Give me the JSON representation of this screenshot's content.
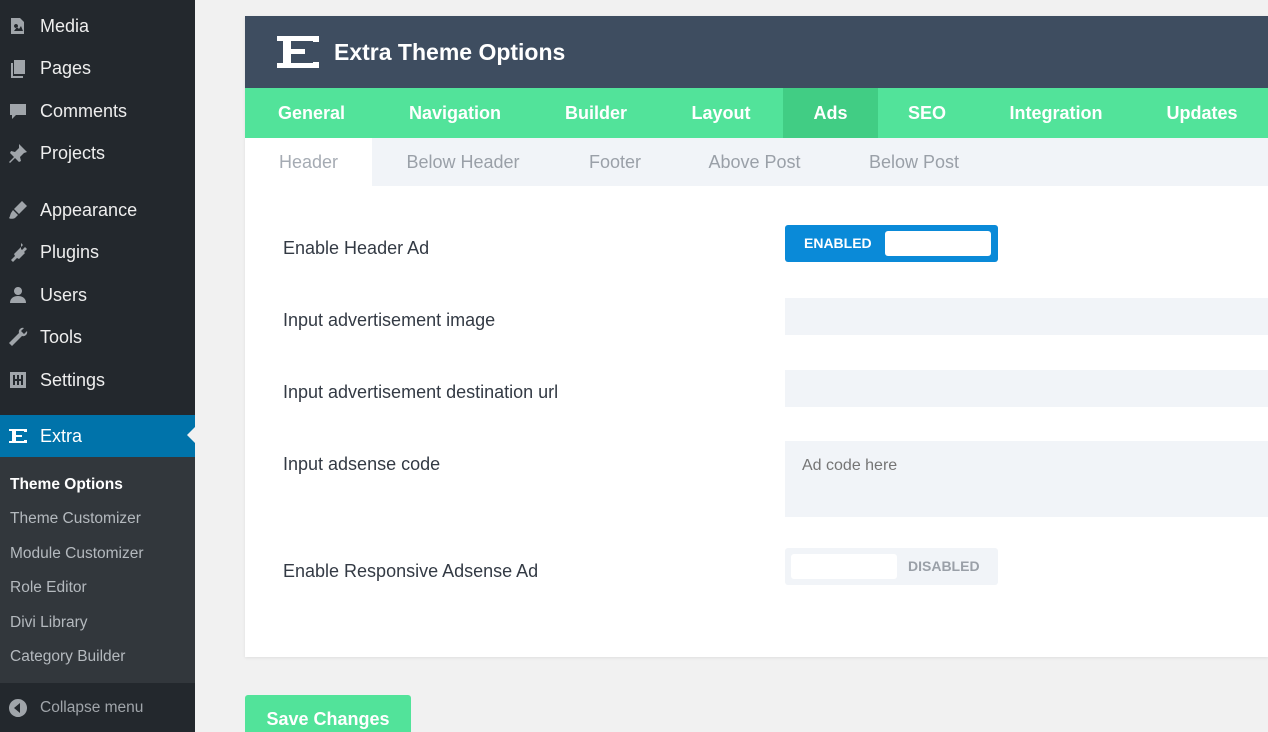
{
  "sidebar": {
    "items": [
      {
        "label": "Media",
        "icon": "media-icon"
      },
      {
        "label": "Pages",
        "icon": "pages-icon"
      },
      {
        "label": "Comments",
        "icon": "comments-icon"
      },
      {
        "label": "Projects",
        "icon": "pin-icon"
      },
      {
        "label": "Appearance",
        "icon": "paintbrush-icon"
      },
      {
        "label": "Plugins",
        "icon": "plugin-icon"
      },
      {
        "label": "Users",
        "icon": "user-icon"
      },
      {
        "label": "Tools",
        "icon": "wrench-icon"
      },
      {
        "label": "Settings",
        "icon": "settings-icon"
      },
      {
        "label": "Extra",
        "icon": "extra-logo-icon",
        "active": true
      }
    ],
    "submenu": [
      {
        "label": "Theme Options",
        "current": true
      },
      {
        "label": "Theme Customizer"
      },
      {
        "label": "Module Customizer"
      },
      {
        "label": "Role Editor"
      },
      {
        "label": "Divi Library"
      },
      {
        "label": "Category Builder"
      }
    ],
    "collapse_label": "Collapse menu"
  },
  "panel": {
    "title": "Extra Theme Options",
    "main_tabs": [
      "General",
      "Navigation",
      "Builder",
      "Layout",
      "Ads",
      "SEO",
      "Integration",
      "Updates"
    ],
    "active_main_tab": "Ads",
    "sub_tabs": [
      "Header",
      "Below Header",
      "Footer",
      "Above Post",
      "Below Post"
    ],
    "active_sub_tab": "Header",
    "fields": {
      "enable_header_ad": {
        "label": "Enable Header Ad",
        "state_label": "ENABLED"
      },
      "ad_image": {
        "label": "Input advertisement image",
        "value": ""
      },
      "ad_url": {
        "label": "Input advertisement destination url",
        "value": ""
      },
      "adsense_code": {
        "label": "Input adsense code",
        "placeholder": "Ad code here"
      },
      "responsive_adsense": {
        "label": "Enable Responsive Adsense Ad",
        "state_label": "DISABLED"
      }
    }
  },
  "save_label": "Save Changes",
  "colors": {
    "sidebar_bg": "#23282d",
    "submenu_bg": "#32373c",
    "active_blue": "#0073aa",
    "header_bg": "#3e4d60",
    "tab_green": "#52e39a",
    "tab_active_green": "#41cd84",
    "toggle_blue": "#0a8ad8"
  }
}
